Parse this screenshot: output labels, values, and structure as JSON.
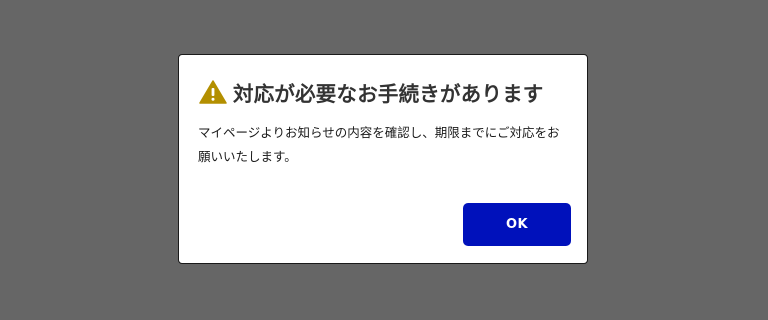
{
  "dialog": {
    "icon": "warning-icon",
    "title": "対応が必要なお手続きがあります",
    "message": "マイページよりお知らせの内容を確認し、期限までにご対応をお願いいたします。",
    "ok_label": "OK"
  },
  "colors": {
    "backdrop": "#666666",
    "dialog_background": "#ffffff",
    "warning_icon": "#b38f00",
    "button_background": "#0011bb",
    "button_text": "#ffffff",
    "title_text": "#333333"
  }
}
